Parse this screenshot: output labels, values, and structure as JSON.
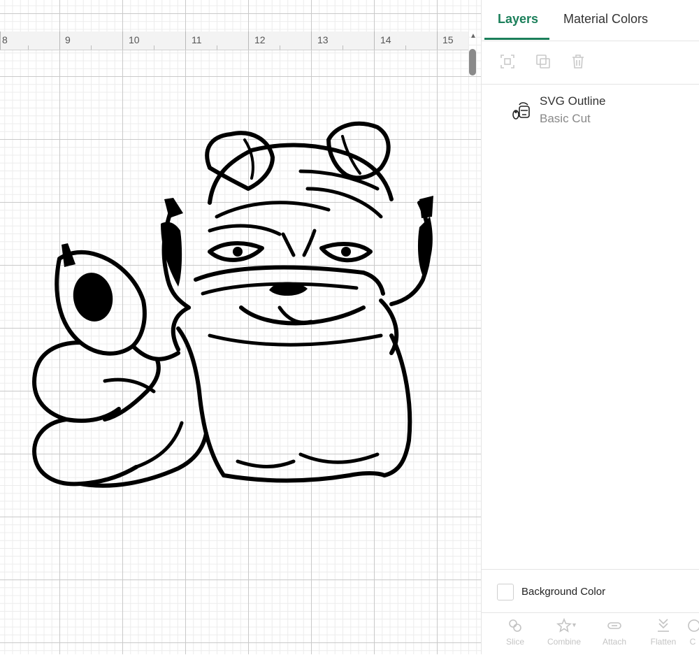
{
  "ruler": {
    "labels": [
      "8",
      "9",
      "10",
      "11",
      "12",
      "13",
      "14",
      "15"
    ]
  },
  "panel": {
    "tabs": [
      {
        "label": "Layers",
        "active": true
      },
      {
        "label": "Material Colors",
        "active": false
      }
    ],
    "tools": [
      "group-icon",
      "duplicate-icon",
      "delete-icon"
    ],
    "layer": {
      "name": "SVG Outline",
      "subtitle": "Basic Cut"
    },
    "background": {
      "label": "Background Color",
      "checked": false
    },
    "actions": [
      {
        "label": "Slice",
        "icon": "slice-icon"
      },
      {
        "label": "Combine",
        "icon": "combine-icon"
      },
      {
        "label": "Attach",
        "icon": "attach-icon"
      },
      {
        "label": "Flatten",
        "icon": "flatten-icon"
      },
      {
        "label": "C",
        "icon": "contour-icon"
      }
    ]
  },
  "colors": {
    "accent": "#1b7f5a",
    "ink": "#000000"
  }
}
